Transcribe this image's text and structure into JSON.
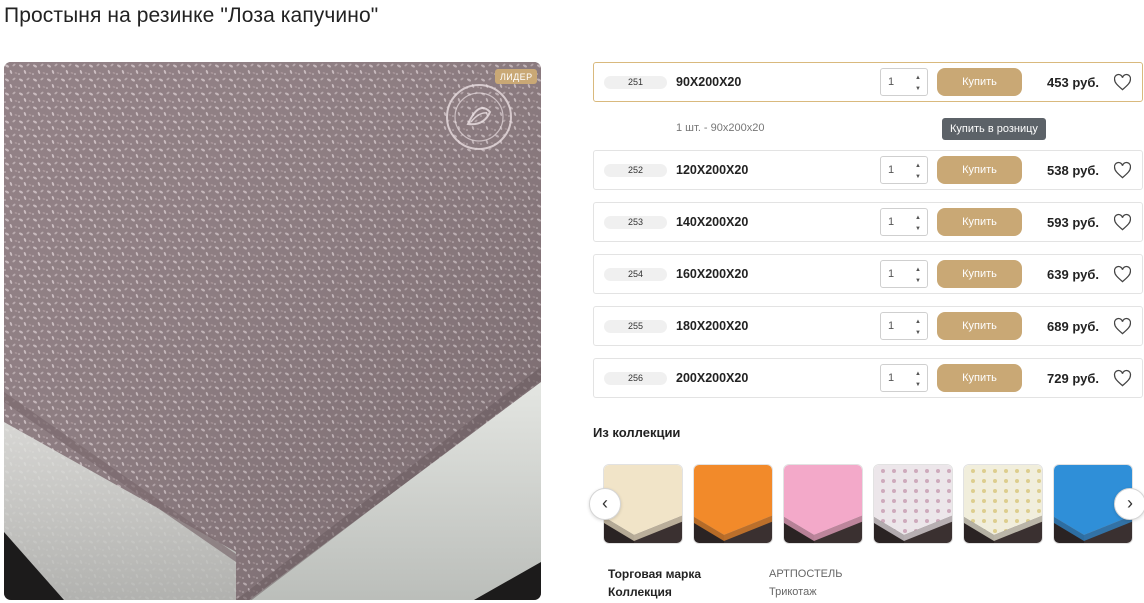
{
  "product": {
    "title": "Простыня на резинке \"Лоза капучино\"",
    "badge": "ЛИДЕР"
  },
  "variants": [
    {
      "sku": "251",
      "size": "90Х200Х20",
      "qty": "1",
      "buy_label": "Купить",
      "price": "453 руб.",
      "active": true
    },
    {
      "sku": "252",
      "size": "120Х200Х20",
      "qty": "1",
      "buy_label": "Купить",
      "price": "538 руб."
    },
    {
      "sku": "253",
      "size": "140Х200Х20",
      "qty": "1",
      "buy_label": "Купить",
      "price": "593 руб."
    },
    {
      "sku": "254",
      "size": "160Х200Х20",
      "qty": "1",
      "buy_label": "Купить",
      "price": "639 руб."
    },
    {
      "sku": "255",
      "size": "180Х200Х20",
      "qty": "1",
      "buy_label": "Купить",
      "price": "689 руб."
    },
    {
      "sku": "256",
      "size": "200Х200Х20",
      "qty": "1",
      "buy_label": "Купить",
      "price": "729 руб."
    }
  ],
  "selected_note": "1 шт. - 90х200х20",
  "tooltip": "Купить в розницу",
  "collection": {
    "title": "Из коллекции",
    "thumbs": [
      {
        "color": "#f1e4c8",
        "name": "cream"
      },
      {
        "color": "#f28a2a",
        "name": "orange"
      },
      {
        "color": "#f3a9c9",
        "name": "pink"
      },
      {
        "color": "#ece6ea",
        "name": "floral-pink"
      },
      {
        "color": "#f1eedc",
        "name": "floral-yellow"
      },
      {
        "color": "#2f8fd8",
        "name": "blue"
      }
    ],
    "prev_icon": "chevron-left-icon",
    "next_icon": "chevron-right-icon"
  },
  "specs": [
    {
      "label": "Торговая марка",
      "value": "АРТПОСТЕЛЬ"
    },
    {
      "label": "Коллекция",
      "value": "Трикотаж"
    }
  ],
  "colors": {
    "accent": "#c9a875",
    "active_border": "#d9b97d",
    "tooltip_bg": "#5c6268"
  }
}
